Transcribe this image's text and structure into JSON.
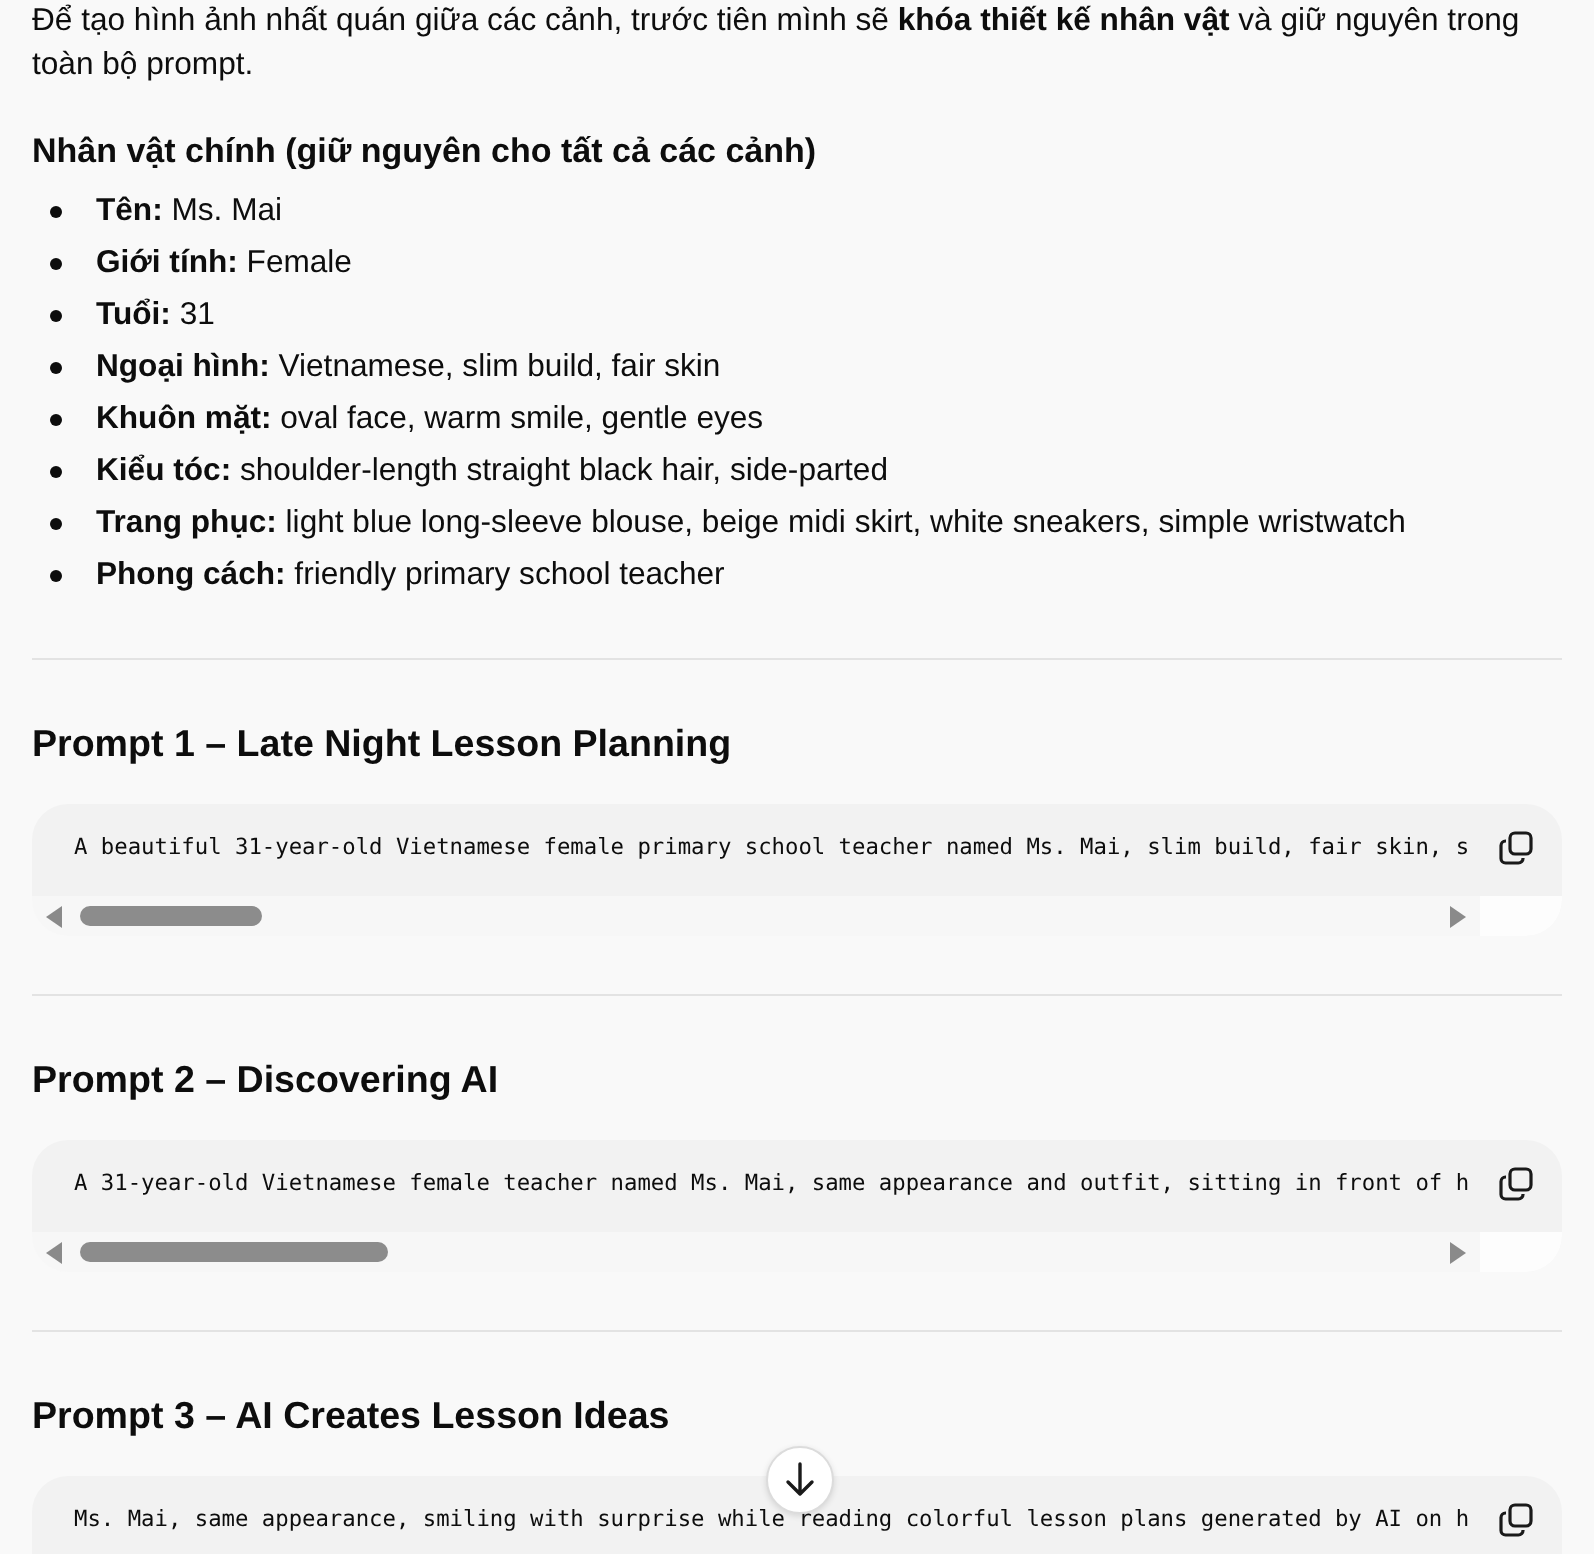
{
  "intro": "Để tạo hình ảnh nhất quán giữa các cảnh, trước tiên mình sẽ **khóa thiết kế nhân vật** và giữ nguyên trong toàn bộ prompt.",
  "character": {
    "heading": "Nhân vật chính (giữ nguyên cho tất cả các cảnh)",
    "items": [
      "**Tên:** Ms. Mai",
      "**Giới tính:** Female",
      "**Tuổi:** 31",
      "**Ngoại hình:** Vietnamese, slim build, fair skin",
      "**Khuôn mặt:** oval face, warm smile, gentle eyes",
      "**Kiểu tóc:** shoulder-length straight black hair, side-parted",
      "**Trang phục:** light blue long-sleeve blouse, beige midi skirt, white sneakers, simple wristwatch",
      "**Phong cách:** friendly primary school teacher"
    ]
  },
  "prompts": [
    {
      "heading": "Prompt 1 – Late Night Lesson Planning",
      "code": "A beautiful 31-year-old Vietnamese female primary school teacher named Ms. Mai, slim build, fair skin, s"
    },
    {
      "heading": "Prompt 2 – Discovering AI",
      "code": "A 31-year-old Vietnamese female teacher named Ms. Mai, same appearance and outfit, sitting in front of h"
    },
    {
      "heading": "Prompt 3 – AI Creates Lesson Ideas",
      "code": "Ms. Mai, same appearance, smiling with surprise while reading colorful lesson plans generated by AI on h"
    }
  ]
}
